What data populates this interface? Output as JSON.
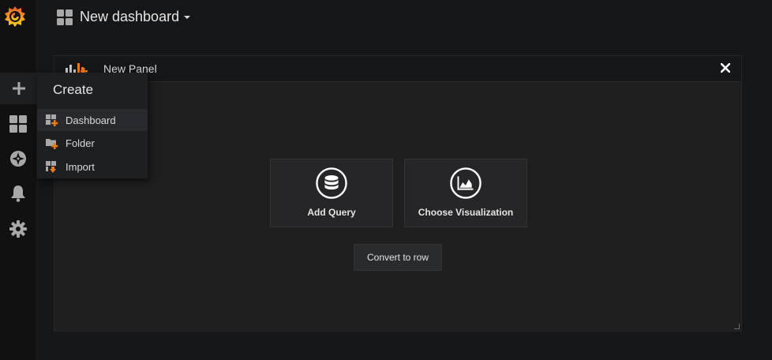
{
  "topnav": {
    "dashboard_title": "New dashboard"
  },
  "sidebar": {
    "items": [
      {
        "icon": "plus-icon",
        "name": "create"
      },
      {
        "icon": "dashboards-icon",
        "name": "dashboards"
      },
      {
        "icon": "compass-icon",
        "name": "explore"
      },
      {
        "icon": "bell-icon",
        "name": "alerting"
      },
      {
        "icon": "gear-icon",
        "name": "configuration"
      }
    ]
  },
  "create_menu": {
    "title": "Create",
    "items": [
      {
        "label": "Dashboard",
        "icon": "dashboard-add-icon"
      },
      {
        "label": "Folder",
        "icon": "folder-add-icon"
      },
      {
        "label": "Import",
        "icon": "import-icon"
      }
    ]
  },
  "panel": {
    "title": "New Panel",
    "add_query_label": "Add Query",
    "choose_visualization_label": "Choose Visualization",
    "convert_to_row_label": "Convert to row"
  },
  "colors": {
    "background": "#161719",
    "sidebar": "#111111",
    "panel": "#1f1f20",
    "accent_orange": "#eb7b18"
  }
}
